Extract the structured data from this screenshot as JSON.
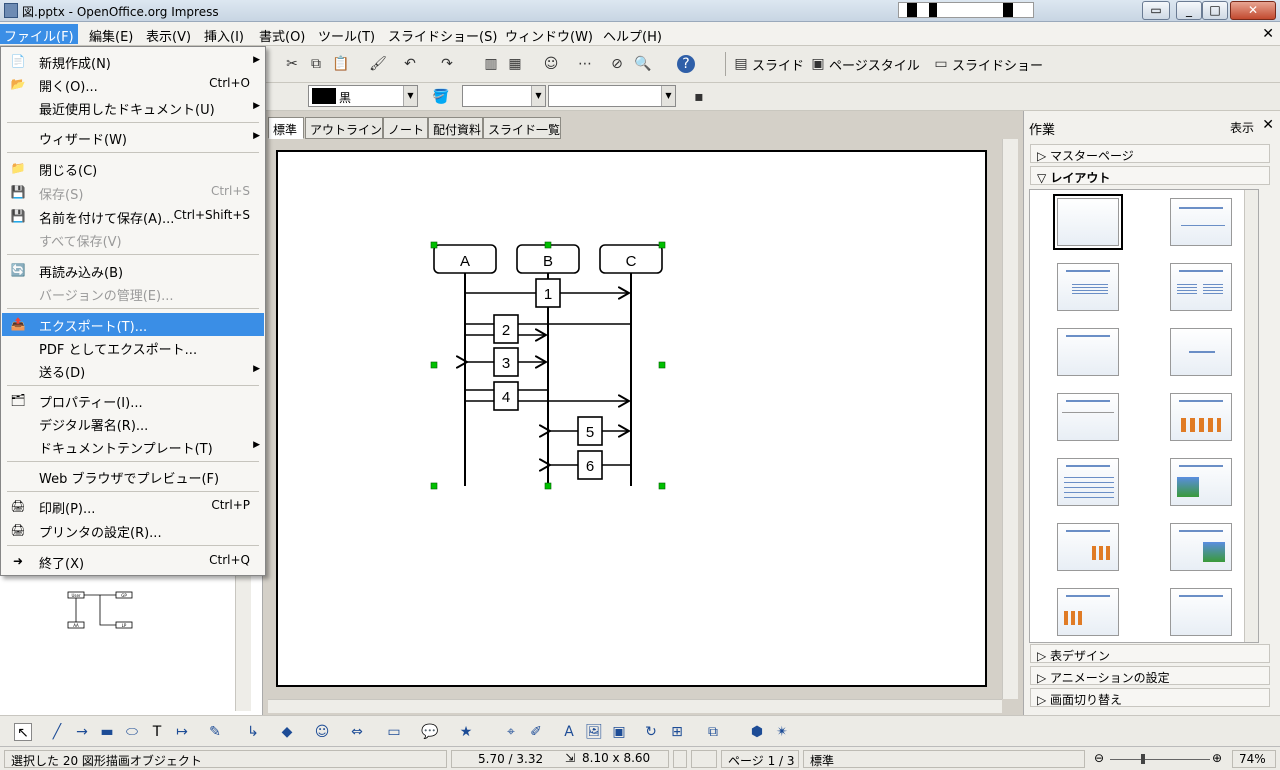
{
  "window": {
    "title": "図.pptx - OpenOffice.org Impress"
  },
  "menubar": [
    "ファイル(F)",
    "編集(E)",
    "表示(V)",
    "挿入(I)",
    "書式(O)",
    "ツール(T)",
    "スライドショー(S)",
    "ウィンドウ(W)",
    "ヘルプ(H)"
  ],
  "toolbar": {
    "slide": "スライド",
    "page_style": "ページスタイル",
    "slideshow": "スライドショー"
  },
  "format": {
    "color_name": "黒",
    "colors": {
      "line": "#000000",
      "handle": "#00c000",
      "highlight": "#3a8ee6"
    }
  },
  "tabs": [
    "標準",
    "アウトライン",
    "ノート",
    "配付資料",
    "スライド一覧"
  ],
  "file_menu": [
    {
      "label": "新規作成(N)",
      "shortcut": "",
      "submenu": true,
      "icon": "new-document-icon"
    },
    {
      "label": "開く(O)...",
      "shortcut": "Ctrl+O",
      "icon": "open-folder-icon"
    },
    {
      "label": "最近使用したドキュメント(U)",
      "shortcut": "",
      "submenu": true
    },
    {
      "label": "ウィザード(W)",
      "shortcut": "",
      "submenu": true
    },
    {
      "label": "閉じる(C)",
      "shortcut": "",
      "icon": "close-document-icon"
    },
    {
      "label": "保存(S)",
      "shortcut": "Ctrl+S",
      "disabled": true,
      "icon": "save-icon"
    },
    {
      "label": "名前を付けて保存(A)...",
      "shortcut": "Ctrl+Shift+S",
      "icon": "save-as-icon"
    },
    {
      "label": "すべて保存(V)",
      "shortcut": "",
      "disabled": true
    },
    {
      "label": "再読み込み(B)",
      "shortcut": "",
      "icon": "reload-icon"
    },
    {
      "label": "バージョンの管理(E)...",
      "shortcut": "",
      "disabled": true
    },
    {
      "label": "エクスポート(T)...",
      "shortcut": "",
      "highlighted": true,
      "icon": "export-icon"
    },
    {
      "label": "PDF としてエクスポート...",
      "shortcut": ""
    },
    {
      "label": "送る(D)",
      "shortcut": "",
      "submenu": true
    },
    {
      "label": "プロパティー(I)...",
      "shortcut": "",
      "icon": "properties-icon"
    },
    {
      "label": "デジタル署名(R)...",
      "shortcut": ""
    },
    {
      "label": "ドキュメントテンプレート(T)",
      "shortcut": "",
      "submenu": true
    },
    {
      "label": "Web ブラウザでプレビュー(F)",
      "shortcut": ""
    },
    {
      "label": "印刷(P)...",
      "shortcut": "Ctrl+P",
      "icon": "print-icon"
    },
    {
      "label": "プリンタの設定(R)...",
      "shortcut": "",
      "icon": "printer-settings-icon"
    },
    {
      "label": "終了(X)",
      "shortcut": "Ctrl+Q",
      "icon": "exit-icon"
    }
  ],
  "diagram": {
    "lifelines": [
      "A",
      "B",
      "C"
    ],
    "messages": [
      "1",
      "2",
      "3",
      "4",
      "5",
      "6"
    ]
  },
  "thumbnail": {
    "labels": [
      "User",
      "GP",
      "AA",
      "LP"
    ]
  },
  "taskpane": {
    "title": "作業",
    "view": "表示",
    "sections": {
      "master": "マスターページ",
      "layout": "レイアウト",
      "table": "表デザイン",
      "animation": "アニメーションの設定",
      "transition": "画面切り替え"
    }
  },
  "status": {
    "selection": "選択した 20 図形描画オブジェクト",
    "position": "5.70 / 3.32",
    "size": "8.10 x 8.60",
    "page": "ページ 1 / 3",
    "layout": "標準",
    "zoom": "74%"
  }
}
